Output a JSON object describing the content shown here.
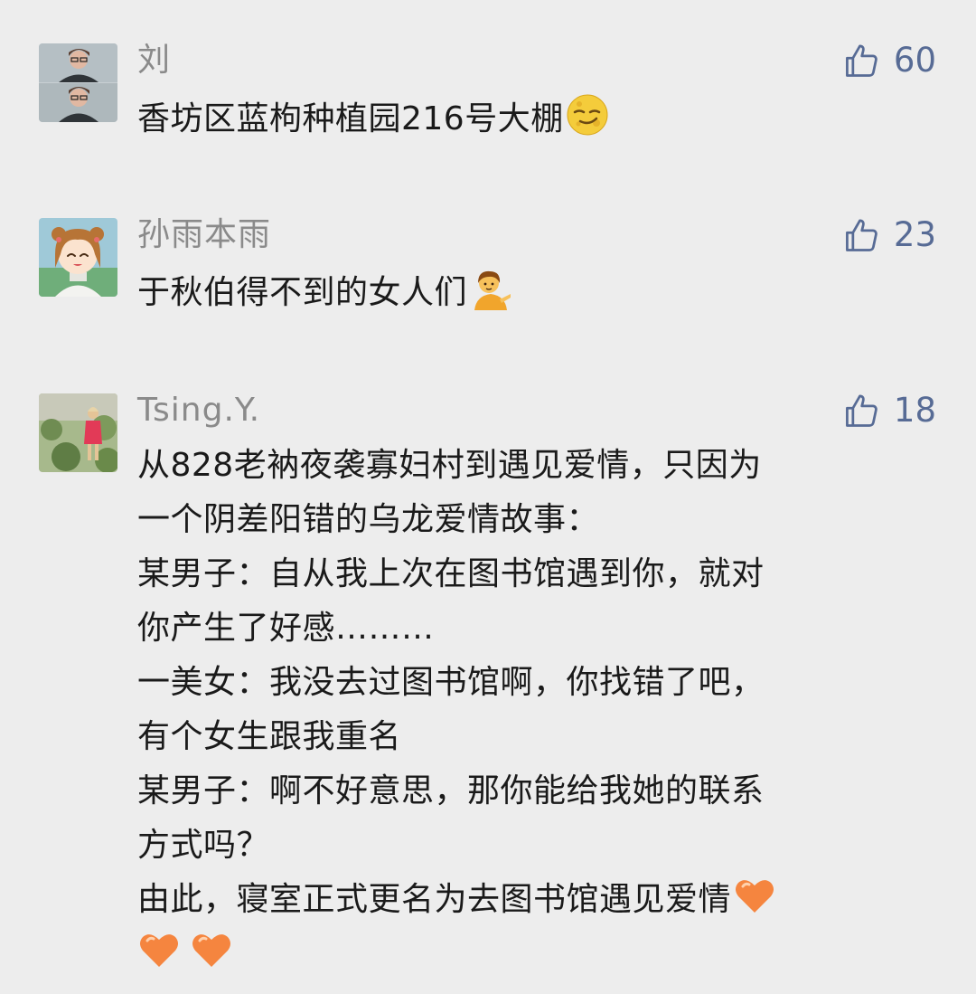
{
  "comments": [
    {
      "name": "刘",
      "likes": "60",
      "avatar_icon": "two-men-photo-avatar",
      "lines": [
        "香坊区蓝枸种植园216号大棚"
      ],
      "trailing_emojis": [
        "smirk-moon-emoji"
      ]
    },
    {
      "name": "孙雨本雨",
      "likes": "23",
      "avatar_icon": "anime-girl-avatar",
      "lines": [
        "于秋伯得不到的女人们"
      ],
      "trailing_emojis": [
        "information-desk-person-emoji"
      ]
    },
    {
      "name": "Tsing.Y.",
      "likes": "18",
      "avatar_icon": "child-in-garden-avatar",
      "lines": [
        "从828老衲夜袭寡妇村到遇见爱情，只因为",
        "一个阴差阳错的乌龙爱情故事：",
        "某男子：自从我上次在图书馆遇到你，就对",
        "你产生了好感………",
        "一美女：我没去过图书馆啊，你找错了吧，",
        "有个女生跟我重名",
        "某男子：啊不好意思，那你能给我她的联系",
        "方式吗？",
        "由此，寝室正式更名为去图书馆遇见爱情"
      ],
      "trailing_emojis": [
        "orange-heart-emoji",
        "orange-heart-emoji",
        "orange-heart-emoji"
      ]
    }
  ],
  "colors": {
    "background": "#ededed",
    "name_text": "#8a8a8a",
    "like_blue": "#576b95",
    "body_text": "#1a1a1a",
    "heart_orange": "#f5853f"
  }
}
